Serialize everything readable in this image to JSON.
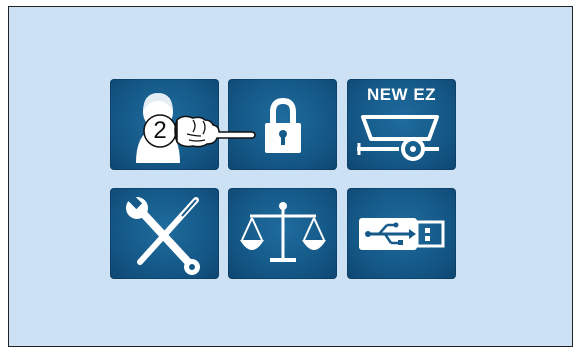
{
  "colors": {
    "screen_background": "#cde1f5",
    "tile_background": "#155a89",
    "icon_color": "#ffffff"
  },
  "tiles": [
    {
      "icon": "user-profile-icon"
    },
    {
      "icon": "padlock-icon"
    },
    {
      "icon": "trailer-icon",
      "label": "NEW EZ"
    },
    {
      "icon": "tools-wrench-screwdriver-icon"
    },
    {
      "icon": "balance-scale-icon"
    },
    {
      "icon": "usb-icon"
    }
  ],
  "callout": {
    "step_number": "2",
    "icon": "pointing-hand-icon"
  }
}
